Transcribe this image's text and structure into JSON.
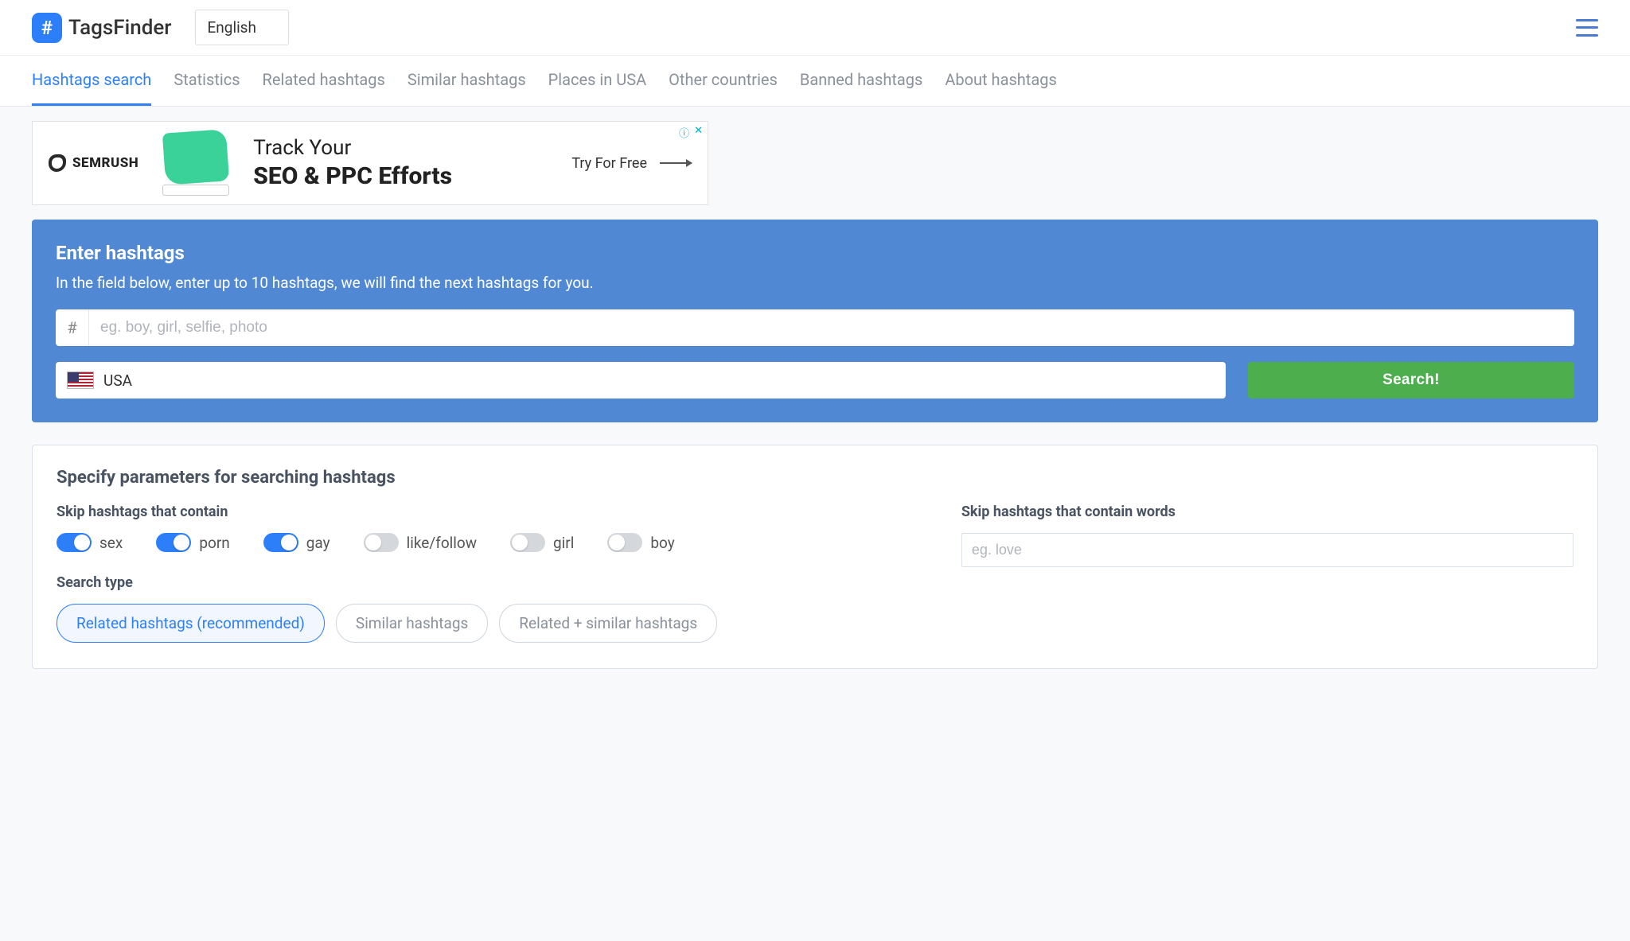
{
  "header": {
    "app_name": "TagsFinder",
    "language": "English"
  },
  "nav": [
    "Hashtags search",
    "Statistics",
    "Related hashtags",
    "Similar hashtags",
    "Places in USA",
    "Other countries",
    "Banned hashtags",
    "About hashtags"
  ],
  "nav_active_index": 0,
  "ad": {
    "brand": "SEMRUSH",
    "line1": "Track Your",
    "line2": "SEO & PPC Efforts",
    "cta": "Try For Free",
    "info_glyph": "ⓘ",
    "close_glyph": "✕"
  },
  "search_panel": {
    "title": "Enter hashtags",
    "subtitle": "In the field below, enter up to 10 hashtags, we will find the next hashtags for you.",
    "hash_prefix": "#",
    "placeholder": "eg. boy, girl, selfie, photo",
    "country": "USA",
    "button": "Search!"
  },
  "params": {
    "title": "Specify parameters for searching hashtags",
    "skip_label": "Skip hashtags that contain",
    "toggles": [
      {
        "label": "sex",
        "on": true
      },
      {
        "label": "porn",
        "on": true
      },
      {
        "label": "gay",
        "on": true
      },
      {
        "label": "like/follow",
        "on": false
      },
      {
        "label": "girl",
        "on": false
      },
      {
        "label": "boy",
        "on": false
      }
    ],
    "skip_words_label": "Skip hashtags that contain words",
    "skip_words_placeholder": "eg. love",
    "search_type_label": "Search type",
    "search_types": [
      "Related hashtags (recommended)",
      "Similar hashtags",
      "Related + similar hashtags"
    ],
    "search_type_active": 0
  }
}
